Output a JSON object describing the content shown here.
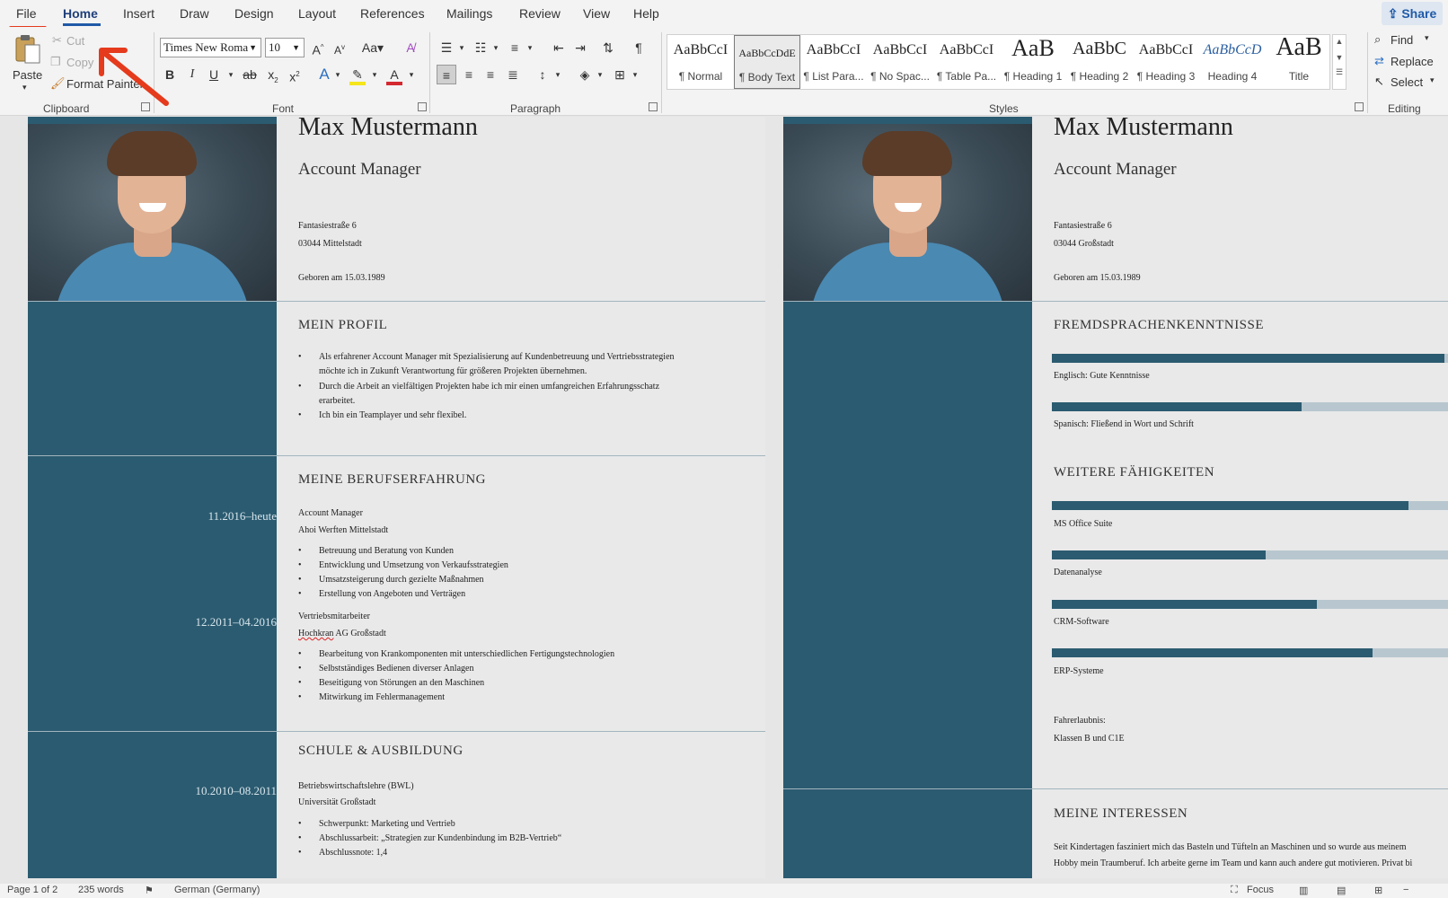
{
  "ribbon": {
    "tabs": [
      "File",
      "Home",
      "Insert",
      "Draw",
      "Design",
      "Layout",
      "References",
      "Mailings",
      "Review",
      "View",
      "Help"
    ],
    "share": "Share",
    "clipboard": {
      "paste": "Paste",
      "cut": "Cut",
      "copy": "Copy",
      "format_painter": "Format Painter",
      "label": "Clipboard"
    },
    "font": {
      "name": "Times New Roma",
      "size": "10",
      "label": "Font"
    },
    "paragraph": {
      "label": "Paragraph"
    },
    "styles": {
      "label": "Styles",
      "items": [
        {
          "sample": "AaBbCcI",
          "name": "¶ Normal"
        },
        {
          "sample": "AaBbCcDdE",
          "name": "¶ Body Text"
        },
        {
          "sample": "AaBbCcI",
          "name": "¶ List Para..."
        },
        {
          "sample": "AaBbCcI",
          "name": "¶ No Spac..."
        },
        {
          "sample": "AaBbCcI",
          "name": "¶ Table Pa..."
        },
        {
          "sample": "AaB",
          "name": "¶ Heading 1"
        },
        {
          "sample": "AaBbC",
          "name": "¶ Heading 2"
        },
        {
          "sample": "AaBbCcI",
          "name": "¶ Heading 3"
        },
        {
          "sample": "AaBbCcD",
          "name": "Heading 4"
        },
        {
          "sample": "AaB",
          "name": "Title"
        }
      ]
    },
    "editing": {
      "find": "Find",
      "replace": "Replace",
      "select": "Select",
      "label": "Editing"
    },
    "colors": {
      "highlight": "#f5e51b",
      "font_color": "#d4282f",
      "annotation": "#e53a1c"
    }
  },
  "page1": {
    "name": "Max Mustermann",
    "role": "Account Manager",
    "street": "Fantasiestraße 6",
    "city": "03044 Mittelstadt",
    "born": "Geboren am 15.03.1989",
    "profile": {
      "heading": "MEIN PROFIL",
      "bullets": [
        "Als erfahrener Account Manager mit Spezialisierung auf Kundenbetreuung und Vertriebsstrategien",
        "Durch die Arbeit an vielfältigen Projekten habe ich mir einen umfangreichen Erfahrungsschatz",
        "Ich bin ein Teamplayer und sehr flexibel."
      ],
      "continuations": [
        "möchte ich in Zukunft Verantwortung für größeren Projekten übernehmen.",
        "erarbeitet."
      ]
    },
    "experience": {
      "heading": "MEINE BERUFSERFAHRUNG",
      "jobs": [
        {
          "date": "11.2016–heute",
          "title": "Account Manager",
          "company": "Ahoi Werften Mittelstadt",
          "bullets": [
            "Betreuung und Beratung von Kunden",
            "Entwicklung und Umsetzung von Verkaufsstrategien",
            "Umsatzsteigerung durch gezielte Maßnahmen",
            "Erstellung von Angeboten und Verträgen"
          ]
        },
        {
          "date": "12.2011–04.2016",
          "title": "Vertriebsmitarbeiter",
          "company_misspelled": "Hochkran",
          "company_rest": " AG Großstadt",
          "bullets": [
            "Bearbeitung von Krankomponenten mit unterschiedlichen Fertigungstechnologien",
            "Selbstständiges Bedienen diverser Anlagen",
            "Beseitigung von Störungen an den Maschinen",
            "Mitwirkung im Fehlermanagement"
          ]
        }
      ]
    },
    "education": {
      "heading": "SCHULE & AUSBILDUNG",
      "date": "10.2010–08.2011",
      "degree": "Betriebswirtschaftslehre (BWL)",
      "school": "Universität Großstadt",
      "bullets": [
        "Schwerpunkt: Marketing und Vertrieb",
        "Abschlussarbeit: „Strategien zur Kundenbindung im B2B-Vertrieb“",
        "Abschlussnote: 1,4"
      ]
    }
  },
  "page2": {
    "name": "Max Mustermann",
    "role": "Account Manager",
    "street": "Fantasiestraße 6",
    "city": "03044 Großstadt",
    "born": "Geboren am 15.03.1989",
    "languages": {
      "heading": "FREMDSPRACHENKENNTNISSE",
      "items": [
        {
          "label": "Englisch: Gute Kenntnisse",
          "level": 0.99
        },
        {
          "label": "Spanisch: Fließend in Wort und Schrift",
          "level": 0.63
        }
      ]
    },
    "skills": {
      "heading": "WEITERE FÄHIGKEITEN",
      "items": [
        {
          "label": "MS Office Suite",
          "level": 0.9
        },
        {
          "label": "Datenanalyse",
          "level": 0.54
        },
        {
          "label": "CRM-Software",
          "level": 0.67
        },
        {
          "label": "ERP-Systeme",
          "level": 0.81
        }
      ]
    },
    "license_label": "Fahrerlaubnis:",
    "license_value": "Klassen B und C1E",
    "interests": {
      "heading": "MEINE INTERESSEN",
      "line1": "Seit Kindertagen fasziniert mich das Basteln und Tüfteln an Maschinen und so wurde aus meinem",
      "line2": "Hobby mein Traumberuf. Ich arbeite gerne im Team und kann auch andere gut motivieren. Privat bi"
    }
  },
  "status": {
    "page": "Page 1 of 2",
    "words": "235 words",
    "language": "German (Germany)",
    "focus": "Focus"
  }
}
